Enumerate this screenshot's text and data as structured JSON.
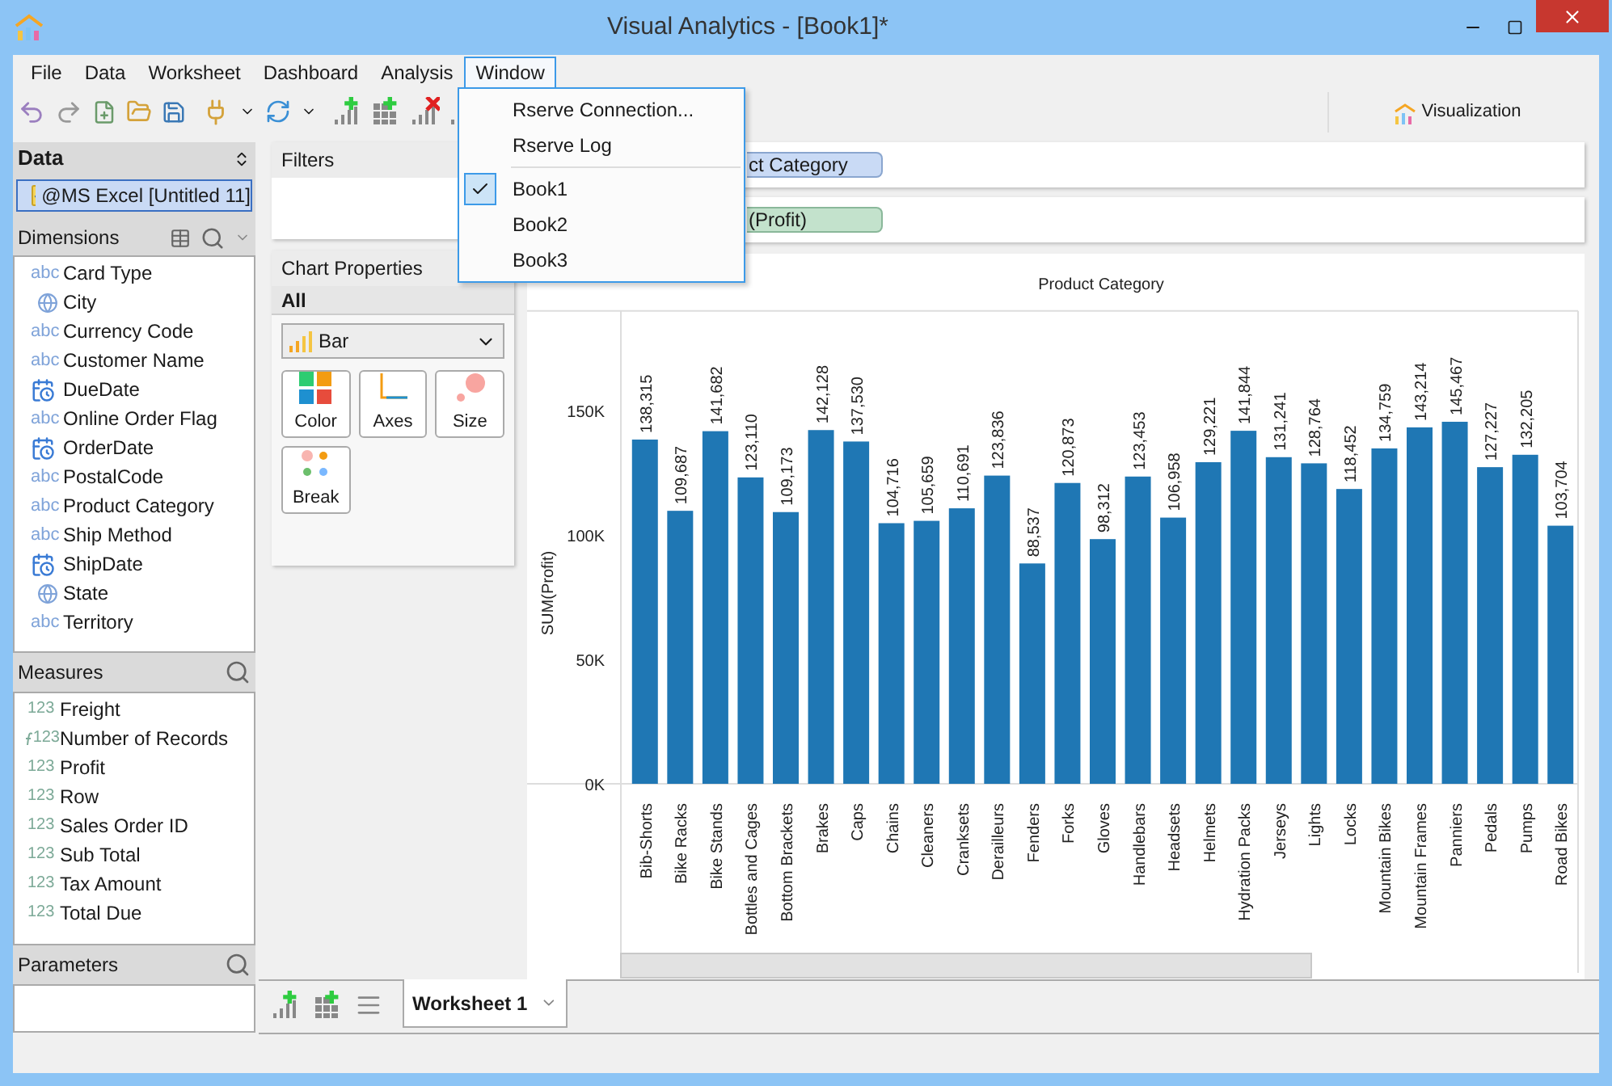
{
  "window": {
    "title": "Visual Analytics - [Book1]*"
  },
  "menu": [
    {
      "label": "File",
      "selected": false
    },
    {
      "label": "Data",
      "selected": false
    },
    {
      "label": "Worksheet",
      "selected": false
    },
    {
      "label": "Dashboard",
      "selected": false
    },
    {
      "label": "Analysis",
      "selected": false
    },
    {
      "label": "Window",
      "selected": true
    }
  ],
  "window_menu": [
    {
      "kind": "item",
      "label": "Rserve Connection...",
      "checked": false
    },
    {
      "kind": "item",
      "label": "Rserve Log",
      "checked": false
    },
    {
      "kind": "separator"
    },
    {
      "kind": "item",
      "label": "Book1",
      "checked": true
    },
    {
      "kind": "item",
      "label": "Book2",
      "checked": false
    },
    {
      "kind": "item",
      "label": "Book3",
      "checked": false
    }
  ],
  "view_tab": {
    "label": "Visualization"
  },
  "data_panel": {
    "title": "Data",
    "source": {
      "label": "@MS Excel [Untitled 11]",
      "selected": true
    }
  },
  "dimensions": {
    "title": "Dimensions",
    "items": [
      {
        "kind": "text",
        "type_label": "abc",
        "label": "Card Type"
      },
      {
        "kind": "geo",
        "label": "City"
      },
      {
        "kind": "text",
        "type_label": "abc",
        "label": "Currency Code"
      },
      {
        "kind": "text",
        "type_label": "abc",
        "label": "Customer Name"
      },
      {
        "kind": "date",
        "label": "DueDate"
      },
      {
        "kind": "text",
        "type_label": "abc",
        "label": "Online Order Flag"
      },
      {
        "kind": "date",
        "label": "OrderDate"
      },
      {
        "kind": "text",
        "type_label": "abc",
        "label": "PostalCode"
      },
      {
        "kind": "text",
        "type_label": "abc",
        "label": "Product Category"
      },
      {
        "kind": "text",
        "type_label": "abc",
        "label": "Ship Method"
      },
      {
        "kind": "date",
        "label": "ShipDate"
      },
      {
        "kind": "geo",
        "label": "State"
      },
      {
        "kind": "text",
        "type_label": "abc",
        "label": "Territory"
      }
    ]
  },
  "measures": {
    "title": "Measures",
    "items": [
      {
        "kind": "number",
        "type_label": "123",
        "label": "Freight"
      },
      {
        "kind": "calc",
        "type_label": "123",
        "label": "Number of Records"
      },
      {
        "kind": "number",
        "type_label": "123",
        "label": "Profit"
      },
      {
        "kind": "number",
        "type_label": "123",
        "label": "Row"
      },
      {
        "kind": "number",
        "type_label": "123",
        "label": "Sales Order ID"
      },
      {
        "kind": "number",
        "type_label": "123",
        "label": "Sub Total"
      },
      {
        "kind": "number",
        "type_label": "123",
        "label": "Tax Amount"
      },
      {
        "kind": "number",
        "type_label": "123",
        "label": "Total Due"
      }
    ]
  },
  "parameters": {
    "title": "Parameters"
  },
  "filters": {
    "title": "Filters"
  },
  "chart_properties": {
    "title": "Chart Properties",
    "section": "All",
    "mark_type": "Bar",
    "buttons": [
      {
        "kind": "color",
        "label": "Color"
      },
      {
        "kind": "axes",
        "label": "Axes"
      },
      {
        "kind": "size",
        "label": "Size"
      },
      {
        "kind": "break",
        "label": "Break"
      }
    ]
  },
  "shelves": [
    {
      "kind": "dimension",
      "pill": "ct Category"
    },
    {
      "kind": "measure",
      "pill": "(Profit)"
    }
  ],
  "chart": {
    "chart_data": {
      "type": "bar",
      "title": "Product Category",
      "ylabel": "SUM(Profit)",
      "categories": [
        "Bib-Shorts",
        "Bike Racks",
        "Bike Stands",
        "Bottles and Cages",
        "Bottom Brackets",
        "Brakes",
        "Caps",
        "Chains",
        "Cleaners",
        "Cranksets",
        "Derailleurs",
        "Fenders",
        "Forks",
        "Gloves",
        "Handlebars",
        "Headsets",
        "Helmets",
        "Hydration Packs",
        "Jerseys",
        "Lights",
        "Locks",
        "Mountain Bikes",
        "Mountain Frames",
        "Panniers",
        "Pedals",
        "Pumps",
        "Road Bikes"
      ],
      "values": [
        138315,
        109687,
        141682,
        123110,
        109173,
        142128,
        137530,
        104716,
        105659,
        110691,
        123836,
        88537,
        120873,
        98312,
        123453,
        106958,
        129221,
        141844,
        131241,
        128764,
        118452,
        134759,
        143214,
        145467,
        127227,
        132205,
        103704
      ],
      "ylim": [
        0,
        190000
      ],
      "value_labels": [
        "138,315",
        "109,687",
        "141,682",
        "123,110",
        "109,173",
        "142,128",
        "137,530",
        "104,716",
        "105,659",
        "110,691",
        "123,836",
        "88,537",
        "120,873",
        "98,312",
        "123,453",
        "106,958",
        "129,221",
        "141,844",
        "131,241",
        "128,764",
        "118,452",
        "134,759",
        "143,214",
        "145,467",
        "127,227",
        "132,205",
        "103,704"
      ],
      "yticks": [
        {
          "value": 0,
          "label": "0K"
        },
        {
          "value": 50000,
          "label": "50K"
        },
        {
          "value": 100000,
          "label": "100K"
        },
        {
          "value": 150000,
          "label": "150K"
        }
      ]
    }
  },
  "sheet_tabs": [
    {
      "label": "Worksheet 1",
      "selected": true
    }
  ]
}
